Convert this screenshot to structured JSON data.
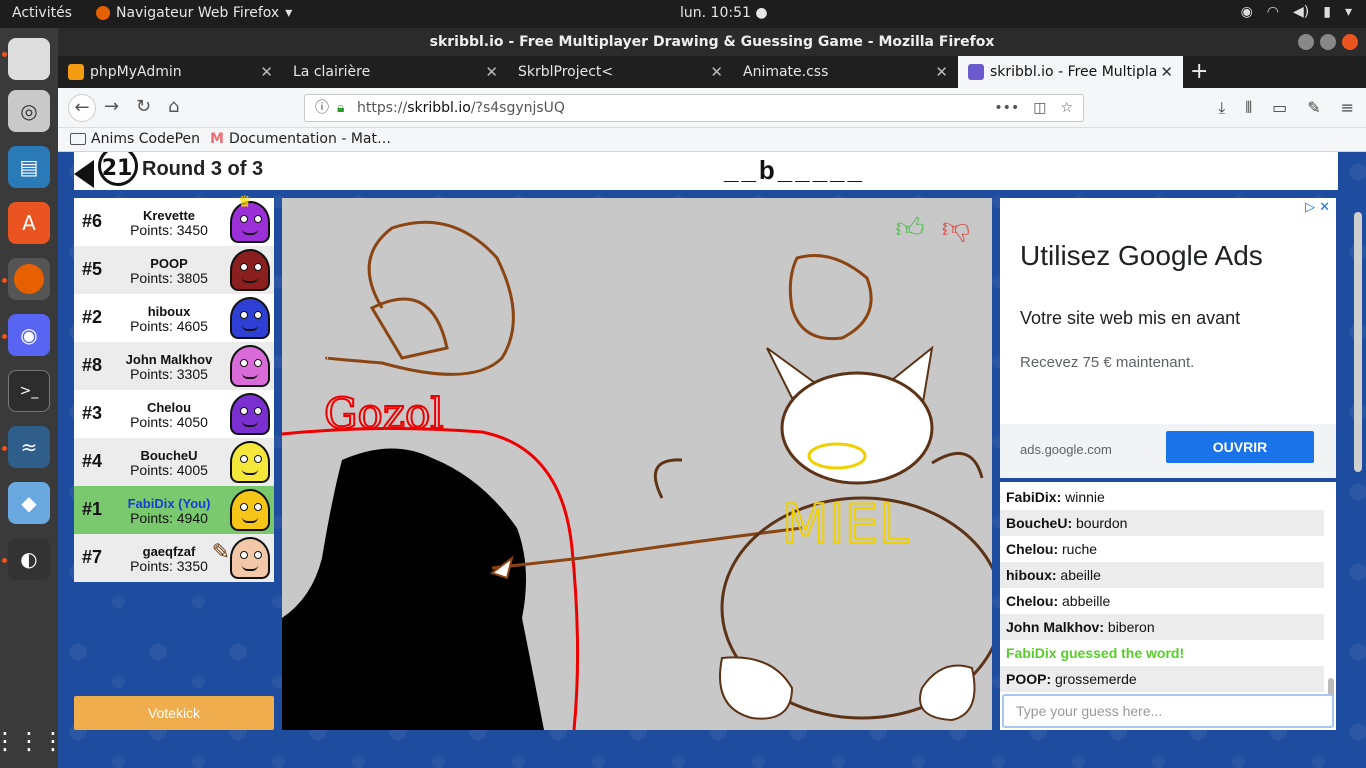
{
  "topbar": {
    "activities": "Activités",
    "app_menu": "Navigateur Web Firefox",
    "clock": "lun. 10:51"
  },
  "window": {
    "title": "skribbl.io - Free Multiplayer Drawing & Guessing Game - Mozilla Firefox"
  },
  "tabs": [
    {
      "label": "phpMyAdmin",
      "color": "#f39c12"
    },
    {
      "label": "La clairière",
      "color": "#888888"
    },
    {
      "label": "SkrblProject<",
      "color": "#888888"
    },
    {
      "label": "Animate.css",
      "color": "#888888"
    },
    {
      "label": "skribbl.io - Free Multipla",
      "color": "#6a5acd"
    }
  ],
  "url": {
    "scheme": "https://",
    "host": "skribbl.io",
    "path": "/?s4sgynjsUQ"
  },
  "bookmarks": [
    {
      "label": "Anims CodePen"
    },
    {
      "label": "Documentation - Mat…"
    }
  ],
  "game": {
    "timer": "21",
    "round_text": "Round 3 of 3",
    "word_hint": "__b_____"
  },
  "players": [
    {
      "rank": "#6",
      "name": "Krevette",
      "points": "Points: 3450",
      "avatar_color": "#9b30d9",
      "me": false,
      "crown": true,
      "drawing": false
    },
    {
      "rank": "#5",
      "name": "POOP",
      "points": "Points: 3805",
      "avatar_color": "#8b1e1e",
      "me": false,
      "crown": false,
      "drawing": false
    },
    {
      "rank": "#2",
      "name": "hiboux",
      "points": "Points: 4605",
      "avatar_color": "#2e3fd4",
      "me": false,
      "crown": false,
      "drawing": false
    },
    {
      "rank": "#8",
      "name": "John Malkhov",
      "points": "Points: 3305",
      "avatar_color": "#d96bd9",
      "me": false,
      "crown": false,
      "drawing": false
    },
    {
      "rank": "#3",
      "name": "Chelou",
      "points": "Points: 4050",
      "avatar_color": "#7a2fd0",
      "me": false,
      "crown": false,
      "drawing": false
    },
    {
      "rank": "#4",
      "name": "BoucheU",
      "points": "Points: 4005",
      "avatar_color": "#f5e83a",
      "me": false,
      "crown": false,
      "drawing": false
    },
    {
      "rank": "#1",
      "name": "FabiDix (You)",
      "points": "Points: 4940",
      "avatar_color": "#f5c518",
      "me": true,
      "crown": false,
      "drawing": false
    },
    {
      "rank": "#7",
      "name": "gaeqfzaf",
      "points": "Points: 3350",
      "avatar_color": "#f2c8a8",
      "me": false,
      "crown": false,
      "drawing": true
    }
  ],
  "votekick_label": "Votekick",
  "canvas_text": {
    "left_label": "Gozol",
    "right_label": "MIEL"
  },
  "ad": {
    "headline": "Utilisez Google Ads",
    "sub": "Votre site web mis en avant",
    "desc": "Recevez 75 € maintenant.",
    "domain": "ads.google.com",
    "cta": "OUVRIR"
  },
  "chat": [
    {
      "who": "FabiDix:",
      "msg": " winnie",
      "type": "msg"
    },
    {
      "who": "BoucheU:",
      "msg": " bourdon",
      "type": "msg"
    },
    {
      "who": "Chelou:",
      "msg": " ruche",
      "type": "msg"
    },
    {
      "who": "hiboux:",
      "msg": " abeille",
      "type": "msg"
    },
    {
      "who": "Chelou:",
      "msg": " abbeille",
      "type": "msg"
    },
    {
      "who": "John Malkhov:",
      "msg": " biberon",
      "type": "msg"
    },
    {
      "who": "",
      "msg": "FabiDix guessed the word!",
      "type": "guessed"
    },
    {
      "who": "POOP:",
      "msg": " grossemerde",
      "type": "msg"
    }
  ],
  "chat_placeholder": "Type your guess here..."
}
